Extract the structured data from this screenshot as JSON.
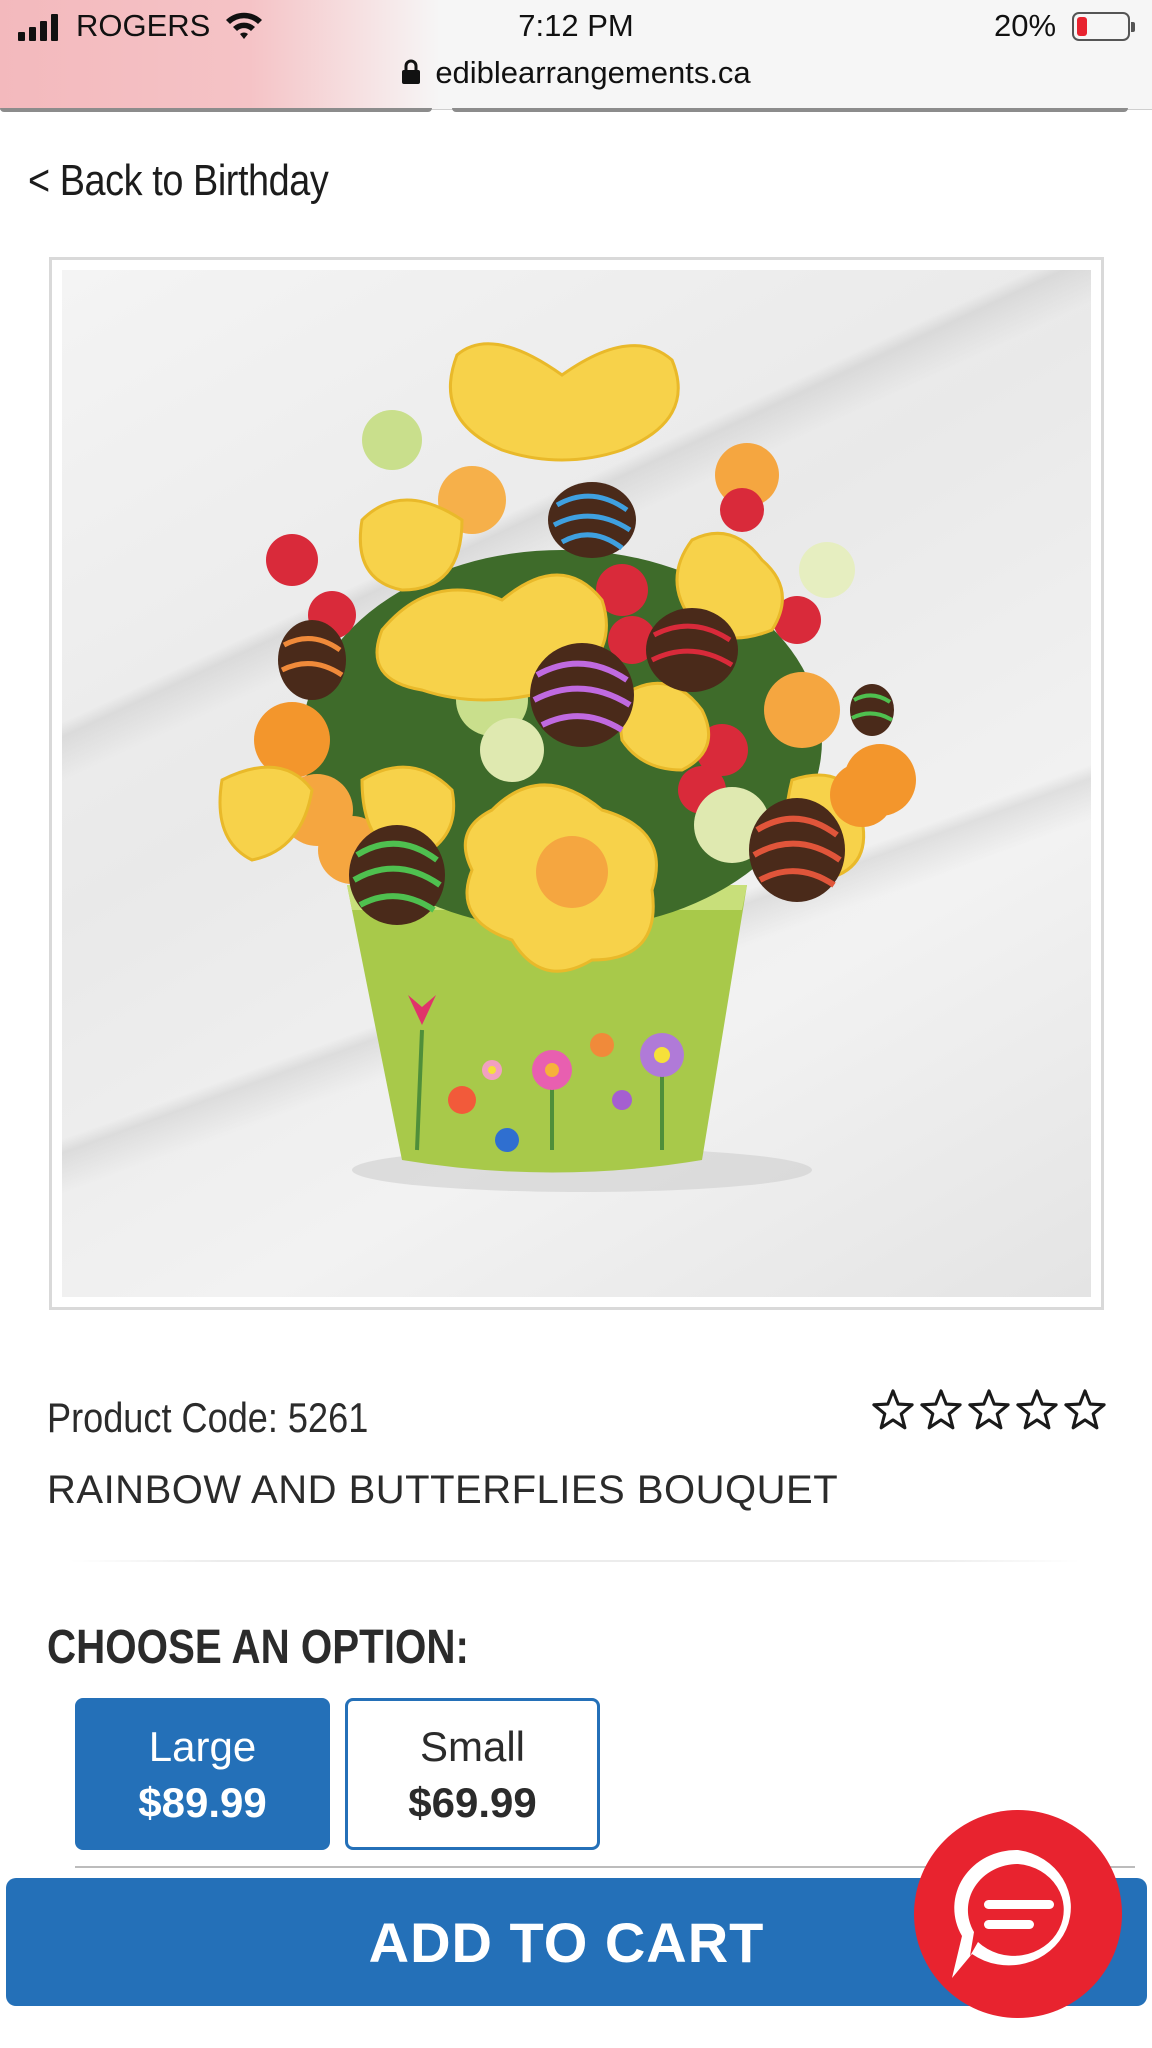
{
  "status_bar": {
    "carrier": "ROGERS",
    "time": "7:12 PM",
    "battery_percent": "20%",
    "battery_color": "#e8232f",
    "url": "ediblearrangements.ca"
  },
  "nav": {
    "back_label": "< Back to Birthday"
  },
  "product": {
    "image_alt_icon": "fruit-bouquet-image",
    "code_label": "Product Code: 5261",
    "title": "RAINBOW AND BUTTERFLIES BOUQUET",
    "rating_stars_filled": 0,
    "rating_stars_total": 5
  },
  "options": {
    "heading": "CHOOSE AN OPTION:",
    "items": [
      {
        "name": "Large",
        "price": "$89.99",
        "selected": true
      },
      {
        "name": "Small",
        "price": "$69.99",
        "selected": false
      }
    ]
  },
  "cart": {
    "add_label": "ADD TO CART"
  },
  "colors": {
    "brand_blue": "#2470b8",
    "chat_red": "#e8232f"
  }
}
